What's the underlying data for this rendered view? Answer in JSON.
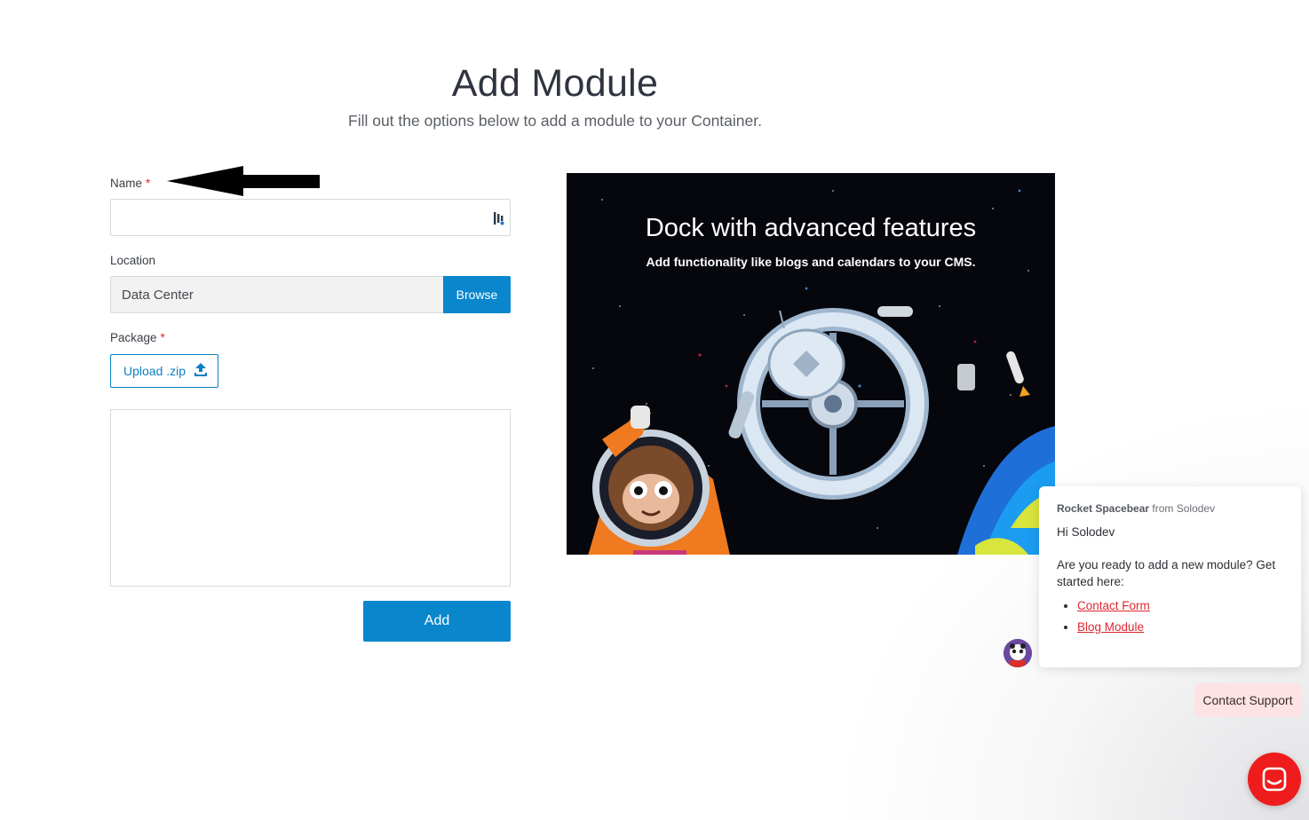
{
  "page": {
    "title": "Add Module",
    "subtitle": "Fill out the options below to add a module to your Container."
  },
  "form": {
    "name_label": "Name",
    "required_mark": "*",
    "name_value": "",
    "location_label": "Location",
    "location_value": "Data Center",
    "browse_label": "Browse",
    "package_label": "Package",
    "upload_label": "Upload .zip",
    "add_label": "Add"
  },
  "banner": {
    "title": "Dock with advanced features",
    "subtitle": "Add functionality like blogs and calendars to your CMS."
  },
  "chat": {
    "sender_name": "Rocket Spacebear",
    "sender_org": "from Solodev",
    "greeting": "Hi Solodev",
    "message": "Are you ready to add a new module? Get started here:",
    "links": [
      "Contact Form",
      "Blog Module"
    ],
    "contact_support_label": "Contact Support"
  },
  "colors": {
    "primary": "#0a86cc",
    "required": "#e0262e",
    "chat_link": "#e0262e",
    "launcher": "#ee1c1c",
    "support_bg": "#fde3e3"
  },
  "icons": {
    "password_manager": "password-manager-icon",
    "upload": "upload-icon",
    "arrow": "arrow-left-annotation",
    "launcher": "chat-launcher-icon"
  }
}
